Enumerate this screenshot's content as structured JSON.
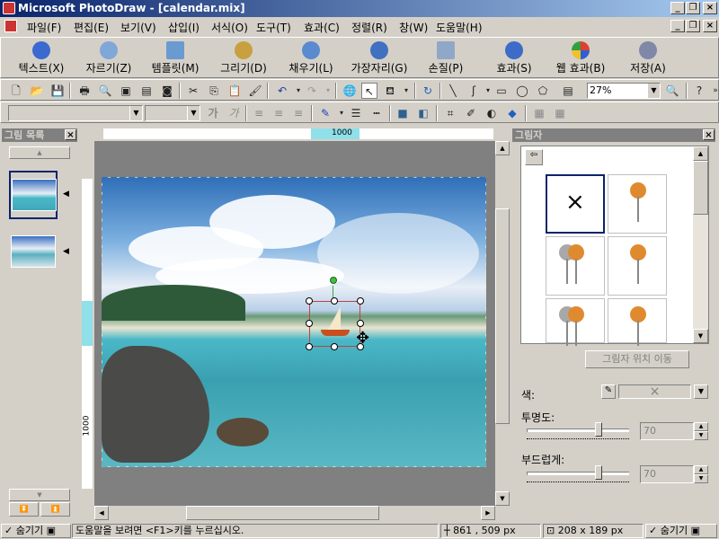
{
  "window": {
    "title": "Microsoft PhotoDraw - [calendar.mix]"
  },
  "menu": [
    "파일(F)",
    "편집(E)",
    "보기(V)",
    "삽입(I)",
    "서식(O)",
    "도구(T)",
    "효과(C)",
    "정렬(R)",
    "창(W)",
    "도움말(H)"
  ],
  "big_toolbar": [
    "텍스트(X)",
    "자르기(Z)",
    "템플릿(M)",
    "그리기(D)",
    "채우기(L)",
    "가장자리(G)",
    "손질(P)",
    "효과(S)",
    "웹 효과(B)",
    "저장(A)"
  ],
  "zoom": {
    "value": "27%"
  },
  "font": {
    "name": "",
    "size": ""
  },
  "picture_list": {
    "title": "그림 목록"
  },
  "ruler": {
    "h_label": "1000",
    "v_label": "1000"
  },
  "shadow_panel": {
    "title": "그림자",
    "move_button": "그림자 위치 이동",
    "color_label": "색:",
    "transparency_label": "투명도:",
    "transparency_value": "70",
    "transparency_level": 0.7,
    "softness_label": "부드럽게:",
    "softness_value": "70",
    "softness_level": 0.7
  },
  "status": {
    "hide_left": "숨기기",
    "help_text": "도움말을 보려면 <F1>키를 누르십시오.",
    "position": "861 , 509  px",
    "size": "208 x 189  px",
    "hide_right": "숨기기"
  },
  "icons": [
    "app-icon",
    "minimize-icon",
    "restore-icon",
    "close-icon",
    "new-file-icon",
    "open-icon",
    "save-icon",
    "print-icon",
    "cut-icon",
    "copy-icon",
    "paste-icon",
    "undo-icon",
    "redo-icon",
    "pointer-icon",
    "zoom-icon",
    "help-icon",
    "pushpin-icon"
  ],
  "colors": {
    "titlebar": "#0a246a",
    "selection": "#0a246a",
    "ruler_highlight": "#8fe0e8"
  }
}
